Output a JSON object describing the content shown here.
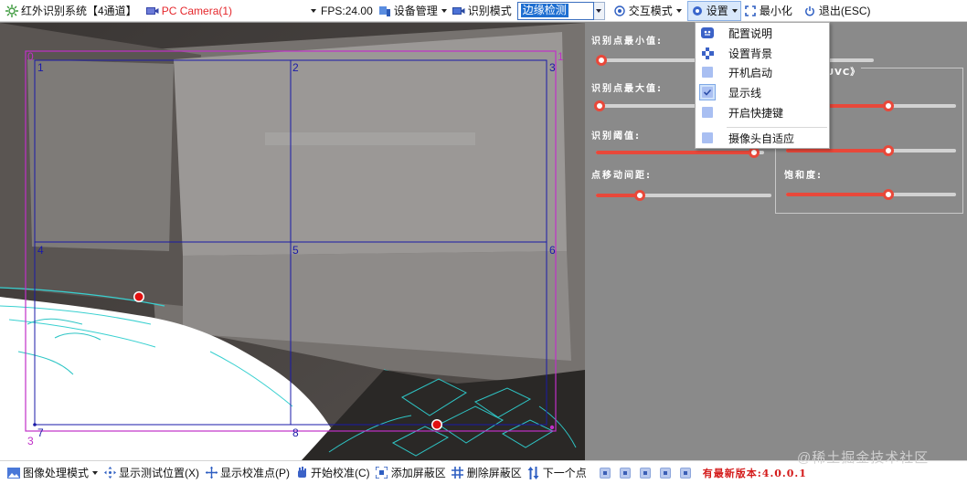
{
  "app": {
    "title": "红外识别系统【4通道】",
    "camera": "PC Camera(1)",
    "fps": "FPS:24.00"
  },
  "toolbar": {
    "device_manage": "设备管理",
    "recognition_mode": "识别模式",
    "mode_value": "边缘检测",
    "interaction_mode": "交互模式",
    "settings": "设置",
    "minimize": "最小化",
    "exit": "退出(ESC)"
  },
  "settings_menu": {
    "items": [
      {
        "label": "配置说明",
        "icon": "config-help-icon"
      },
      {
        "label": "设置背景",
        "icon": "background-icon"
      },
      {
        "label": "开机启动",
        "icon": "checkbox-icon",
        "checked": false
      },
      {
        "label": "显示线",
        "icon": "checkbox-icon",
        "checked": true
      },
      {
        "label": "开启快捷键",
        "icon": "checkbox-icon",
        "checked": false
      },
      {
        "label": "摄像头自适应",
        "icon": "checkbox-icon",
        "checked": false
      }
    ]
  },
  "panel": {
    "min_point_label": "识别点最小值:",
    "max_point_label": "识别点最大值:",
    "threshold_label": "识别阈值:",
    "move_spacing_label": "点移动间距:",
    "group_title": "UVC》",
    "saturation_label": "饱和度:",
    "sliders": {
      "min_point": 0.02,
      "max_point": 0.02,
      "threshold": 0.94,
      "move_spacing": 0.25,
      "uvc_1": 0.6,
      "uvc_2": 0.6,
      "saturation": 0.6
    }
  },
  "overlay": {
    "outer_labels": [
      "0",
      "1",
      "3"
    ],
    "grid_labels": [
      "1",
      "2",
      "3",
      "4",
      "5",
      "6",
      "7",
      "8"
    ],
    "outer_color": "#c030c8",
    "grid_color": "#1a1aa8",
    "point_color": "#e01010"
  },
  "bottom": {
    "image_mode": "图像处理模式",
    "show_test_position": "显示测试位置(X)",
    "show_calibration_points": "显示校准点(P)",
    "start_calibration": "开始校准(C)",
    "add_mask": "添加屏蔽区",
    "delete_mask": "删除屏蔽区",
    "next_point": "下一个点",
    "version": "有最新版本:4.0.0.1",
    "watermark": "@稀土掘金技术社区"
  }
}
